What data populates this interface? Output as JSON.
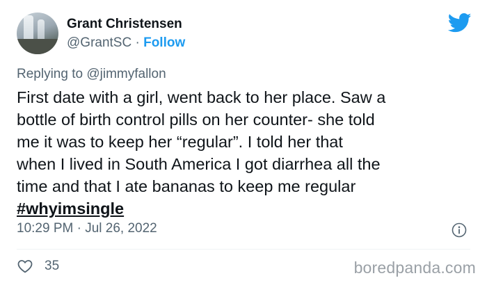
{
  "author": {
    "name": "Grant Christensen",
    "handle": "@GrantSC",
    "separator": "·",
    "follow_label": "Follow"
  },
  "reply": {
    "prefix": "Replying to",
    "mention": "@jimmyfallon"
  },
  "tweet": {
    "lines": [
      "First date with a girl, went back to her place. Saw a",
      "bottle of birth control pills on her counter- she told",
      "me it was to keep her “regular”. I told her that",
      "when I lived in South America I got diarrhea all the",
      "time and that I ate bananas to keep me regular"
    ],
    "hashtag": "#whyimsingle"
  },
  "meta": {
    "time": "10:29 PM",
    "separator": "·",
    "date": "Jul 26, 2022"
  },
  "engagement": {
    "likes": "35"
  },
  "watermark": "boredpanda.com",
  "icons": [
    "twitter-bird-icon",
    "info-icon",
    "heart-icon"
  ],
  "colors": {
    "accent": "#1d9bf0",
    "secondary_text": "#536471",
    "primary_text": "#0f1419"
  }
}
